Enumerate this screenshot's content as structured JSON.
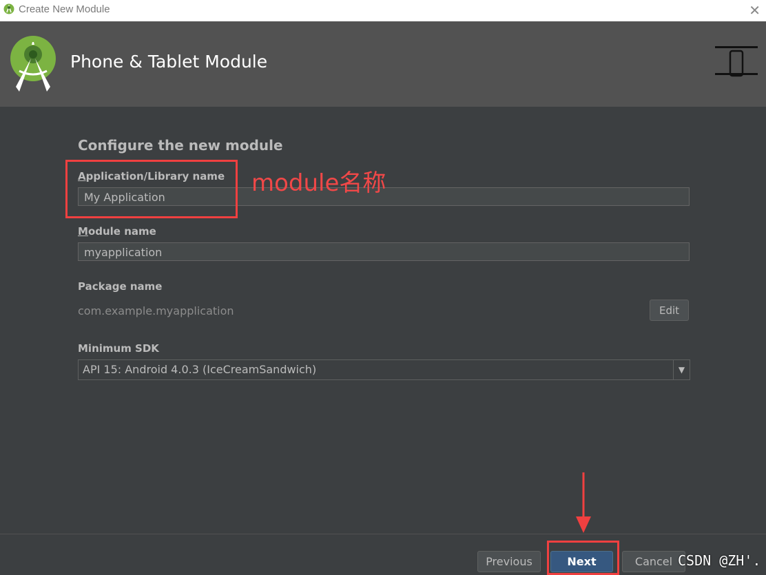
{
  "window": {
    "title": "Create New Module"
  },
  "header": {
    "title": "Phone & Tablet Module"
  },
  "form": {
    "section_title": "Configure the new module",
    "app_name": {
      "label_mnemonic": "A",
      "label_rest": "pplication/Library name",
      "value": "My Application"
    },
    "module_name": {
      "label_mnemonic": "M",
      "label_rest": "odule name",
      "value": "myapplication"
    },
    "package": {
      "label": "Package name",
      "value": "com.example.myapplication",
      "edit_label": "Edit"
    },
    "min_sdk": {
      "label": "Minimum SDK",
      "value": "API 15: Android 4.0.3 (IceCreamSandwich)"
    }
  },
  "footer": {
    "previous": "Previous",
    "next": "Next",
    "cancel": "Cancel"
  },
  "annotation": {
    "text": "module名称",
    "color": "#f04848"
  },
  "watermark": "CSDN @ZH'.",
  "icons": [
    "android-studio-icon",
    "android-studio-logo",
    "phone-tablet-icon",
    "close-icon",
    "dropdown-arrow-icon",
    "red-arrow"
  ]
}
